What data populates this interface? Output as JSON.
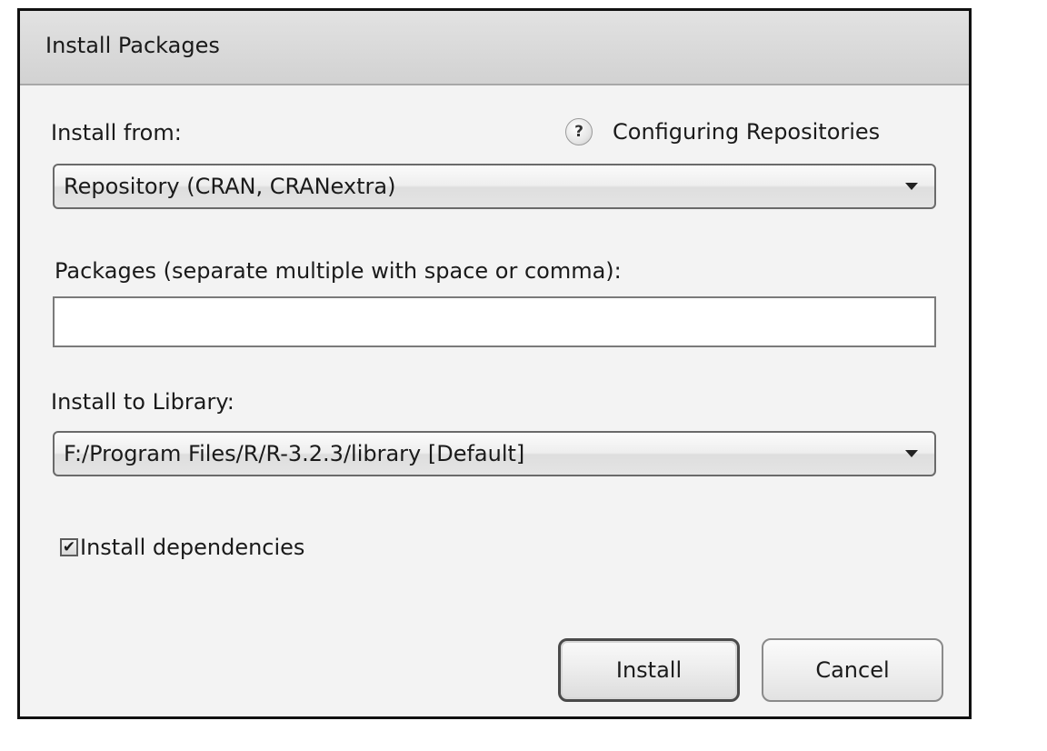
{
  "dialog": {
    "title": "Install Packages"
  },
  "install_from": {
    "label": "Install from:",
    "selected": "Repository (CRAN, CRANextra)"
  },
  "help": {
    "icon": "?",
    "icon_name": "help-icon",
    "link_text": "Configuring Repositories"
  },
  "packages": {
    "label": "Packages (separate multiple with space or comma):",
    "value": "",
    "placeholder": ""
  },
  "install_to_library": {
    "label": "Install to Library:",
    "selected": "F:/Program Files/R/R-3.2.3/library [Default]"
  },
  "dependencies": {
    "checked": true,
    "check_glyph": "✔",
    "label": "Install dependencies"
  },
  "buttons": {
    "install": "Install",
    "cancel": "Cancel"
  }
}
